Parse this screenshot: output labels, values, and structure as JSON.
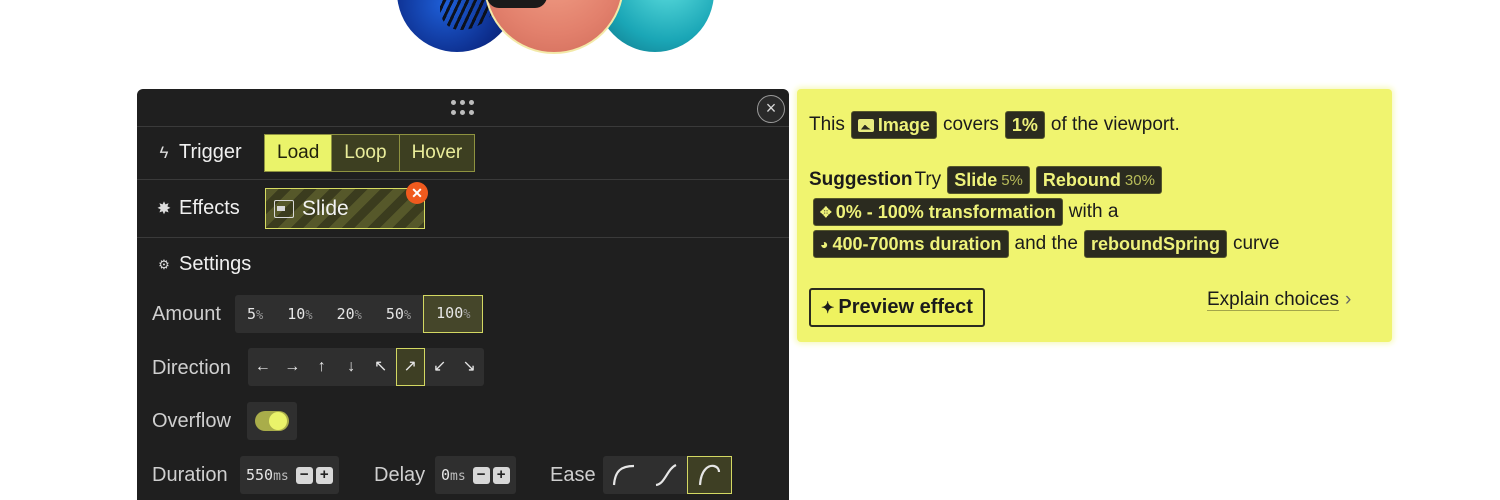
{
  "panel": {
    "trigger": {
      "label": "Trigger",
      "options": [
        "Load",
        "Loop",
        "Hover"
      ],
      "selected": "Load"
    },
    "effects": {
      "label": "Effects",
      "chip": "Slide"
    },
    "settings": {
      "label": "Settings",
      "amount": {
        "label": "Amount",
        "options": [
          {
            "num": "5",
            "unit": "%"
          },
          {
            "num": "10",
            "unit": "%"
          },
          {
            "num": "20",
            "unit": "%"
          },
          {
            "num": "50",
            "unit": "%"
          },
          {
            "num": "100",
            "unit": "%"
          }
        ],
        "selected": "100"
      },
      "direction": {
        "label": "Direction",
        "options": [
          "←",
          "→",
          "↑",
          "↓",
          "↖",
          "↗",
          "↙",
          "↘"
        ],
        "selected": "↗"
      },
      "overflow": {
        "label": "Overflow",
        "on": true
      },
      "duration": {
        "label": "Duration",
        "num": "550",
        "unit": "ms"
      },
      "delay": {
        "label": "Delay",
        "num": "0",
        "unit": "ms"
      },
      "ease": {
        "label": "Ease",
        "options": [
          "ease-in-curve",
          "ease-out-curve",
          "spring-curve"
        ],
        "selected": "spring-curve"
      }
    }
  },
  "suggestion": {
    "line1": {
      "pre": "This",
      "element": "Image",
      "mid": "covers",
      "coverage": "1%",
      "post": "of the viewport."
    },
    "line2": {
      "head": "Suggestion",
      "try": "Try",
      "opt1": "Slide",
      "opt1_pct": "5%",
      "opt2": "Rebound",
      "opt2_pct": "30%"
    },
    "line3": {
      "transform": "0% - 100% transformation",
      "post": "with a"
    },
    "line4": {
      "duration": "400-700ms duration",
      "mid": "and the",
      "curve": "reboundSpring",
      "post": "curve"
    },
    "preview_label": "Preview effect",
    "explain_label": "Explain choices",
    "explain_chevron": "›"
  },
  "colors": {
    "accent": "#eaf36a",
    "panel_bg": "#1f1f1f",
    "card_bg": "#f0f46f",
    "close_badge": "#f05a1e"
  }
}
